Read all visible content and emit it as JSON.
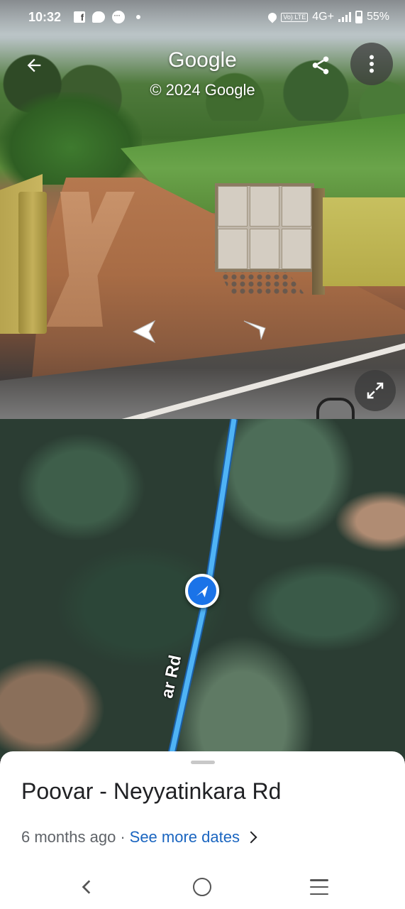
{
  "status_bar": {
    "time": "10:32",
    "network": "4G+",
    "volte_label": "Vo) LTE",
    "battery": "55%",
    "notification_icons": [
      "facebook-icon",
      "chat-icon",
      "messenger-icon",
      "dot-icon"
    ]
  },
  "street_view": {
    "title": "Google",
    "copyright": "© 2024 Google"
  },
  "map": {
    "road_label": "ar Rd",
    "route_color": "#4fb3f5",
    "pin_color": "#1a73e8"
  },
  "sheet": {
    "title": "Poovar - Neyyatinkara Rd",
    "age": "6 months ago",
    "separator": "·",
    "see_more": "See more dates"
  }
}
